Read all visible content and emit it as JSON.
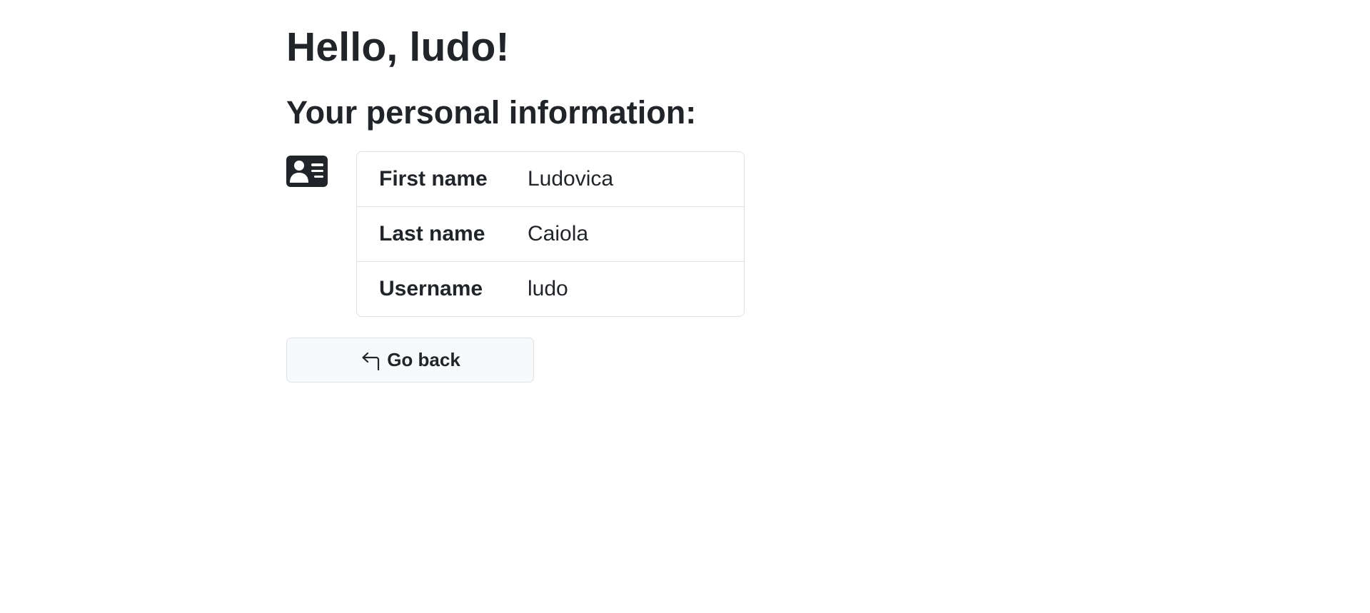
{
  "page": {
    "greeting": "Hello, ludo!",
    "subheading": "Your personal information:"
  },
  "icons": {
    "card": "person-vcard-icon",
    "back": "arrow-return-left-icon"
  },
  "info_table": {
    "rows": [
      {
        "label": "First name",
        "value": "Ludovica"
      },
      {
        "label": "Last name",
        "value": "Caiola"
      },
      {
        "label": "Username",
        "value": "ludo"
      }
    ]
  },
  "actions": {
    "back_label": "Go back"
  },
  "colors": {
    "text": "#212529",
    "border": "#dee2e6",
    "button_bg": "#f8f9fa"
  }
}
